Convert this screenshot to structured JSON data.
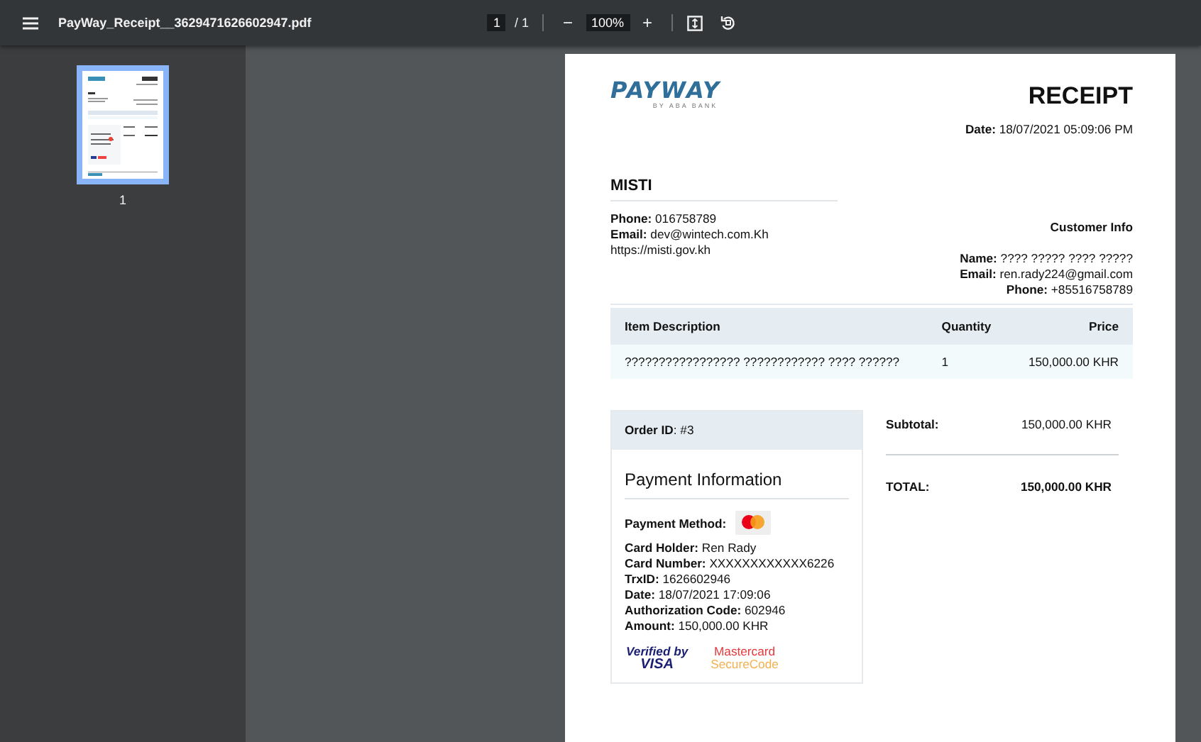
{
  "toolbar": {
    "filename": "PayWay_Receipt__3629471626602947.pdf",
    "page_input": "1",
    "page_count": "/ 1",
    "zoom_out": "−",
    "zoom": "100%",
    "zoom_in": "+"
  },
  "sidebar": {
    "thumbnails": [
      {
        "page": "1",
        "selected": true
      }
    ]
  },
  "receipt": {
    "logo": {
      "name": "PAYWAY",
      "tagline": "BY ABA BANK"
    },
    "title": "RECEIPT",
    "date": "**Date:** 18/07/2021 05:09:06 PM",
    "merchant": {
      "name": "MISTI",
      "lines": [
        "**Phone:** 016758789",
        "**Email:** dev@wintech.com.Kh",
        "https://misti.gov.kh"
      ]
    },
    "customer": {
      "heading": "Customer Info",
      "lines": [
        "**Name:** ???? ????? ???? ?????",
        "**Email:** ren.rady224@gmail.com",
        "**Phone:** +85516758789"
      ]
    },
    "table": {
      "columns": [
        "Item Description",
        "Quantity",
        "Price"
      ],
      "rows": [
        [
          "????????????????? ???????????? ???? ??????",
          "1",
          "150,000.00 KHR"
        ]
      ]
    },
    "order": {
      "id": "**Order ID**: #3",
      "heading": "Payment Information",
      "method": "Payment Method:",
      "lines": [
        "**Card Holder:** Ren Rady",
        "**Card Number:** XXXXXXXXXXXX6226",
        "**TrxID:** 1626602946",
        "**Date:** 18/07/2021 17:09:06",
        "**Authorization Code:** 602946",
        "**Amount:** 150,000.00 KHR"
      ],
      "badges": [
        {
          "kind": "visa",
          "top": "Verified by",
          "bottom": "VISA"
        },
        {
          "kind": "securecode",
          "top": "Mastercard",
          "bottom": "SecureCode"
        }
      ]
    },
    "totals": [
      {
        "kind": "subtotal",
        "label": "Subtotal:",
        "value": "150,000.00 KHR"
      },
      {
        "kind": "total",
        "label": "TOTAL:",
        "value": "150,000.00 KHR"
      }
    ]
  }
}
